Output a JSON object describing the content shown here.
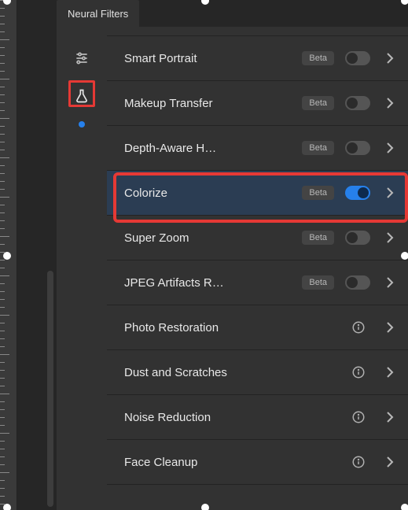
{
  "tab": {
    "title": "Neural Filters"
  },
  "sidebar": {
    "icons": [
      "sliders",
      "beaker"
    ],
    "active": "beaker"
  },
  "filters": [
    {
      "label": "Smart Portrait",
      "badge": "Beta",
      "toggle": "off"
    },
    {
      "label": "Makeup Transfer",
      "badge": "Beta",
      "toggle": "off"
    },
    {
      "label": "Depth-Aware H…",
      "badge": "Beta",
      "toggle": "off"
    },
    {
      "label": "Colorize",
      "badge": "Beta",
      "toggle": "on",
      "selected": true
    },
    {
      "label": "Super Zoom",
      "badge": "Beta",
      "toggle": "off"
    },
    {
      "label": "JPEG Artifacts R…",
      "badge": "Beta",
      "toggle": "off"
    },
    {
      "label": "Photo Restoration",
      "info": true
    },
    {
      "label": "Dust and Scratches",
      "info": true
    },
    {
      "label": "Noise Reduction",
      "info": true
    },
    {
      "label": "Face Cleanup",
      "info": true
    }
  ],
  "colors": {
    "accent": "#2680eb",
    "highlight": "#e53935"
  }
}
